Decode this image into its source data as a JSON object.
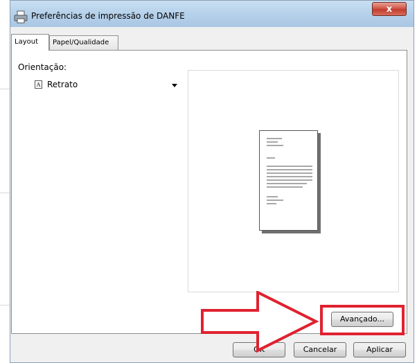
{
  "window": {
    "title": "Preferências de impressão de DANFE",
    "close_label": "x",
    "close_icon": "close-icon"
  },
  "tabs": [
    {
      "label": "Layout",
      "active": true
    },
    {
      "label": "Papel/Qualidade",
      "active": false
    }
  ],
  "orientation": {
    "label": "Orientação:",
    "selected": "Retrato",
    "icon": "portrait-page-icon",
    "icon_glyph": "A"
  },
  "buttons": {
    "advanced": "Avançado...",
    "ok": "OK",
    "cancel": "Cancelar",
    "apply": "Aplicar"
  },
  "annotation": {
    "color": "#e0212f",
    "target": "advanced"
  }
}
